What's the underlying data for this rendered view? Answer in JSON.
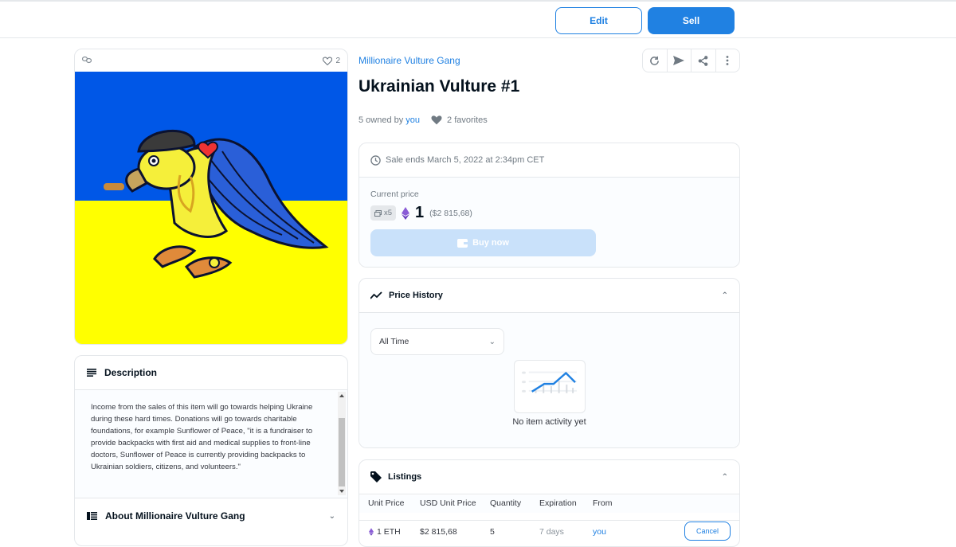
{
  "topbar": {
    "edit_label": "Edit",
    "sell_label": "Sell"
  },
  "media": {
    "favorites_count": "2"
  },
  "description": {
    "title": "Description",
    "text": "Income from the sales of this item will go towards helping Ukraine during these hard times. Donations will go towards charitable foundations, for example Sunflower of Peace, \"it is a fundraiser to provide backpacks with first aid and medical supplies to front-line doctors, Sunflower of Peace is currently providing backpacks to Ukrainian soldiers, citizens, and volunteers.\""
  },
  "about": {
    "title": "About Millionaire Vulture Gang"
  },
  "item": {
    "collection": "Millionaire Vulture Gang",
    "title": "Ukrainian Vulture #1",
    "owned_text": "5 owned by",
    "owner": "you",
    "favorites_text": "2 favorites"
  },
  "sale": {
    "ends_text": "Sale ends March 5, 2022 at 2:34pm CET",
    "current_price_label": "Current price",
    "quantity": "x5",
    "price": "1",
    "price_usd": "($2 815,68)",
    "buy_label": "Buy now"
  },
  "price_history": {
    "title": "Price History",
    "range": "All Time",
    "empty_text": "No item activity yet"
  },
  "listings": {
    "title": "Listings",
    "columns": [
      "Unit Price",
      "USD Unit Price",
      "Quantity",
      "Expiration",
      "From"
    ],
    "rows": [
      {
        "unit_price": "1 ETH",
        "usd_price": "$2 815,68",
        "quantity": "5",
        "expiration": "7 days",
        "from": "you",
        "action": "Cancel"
      }
    ]
  },
  "colors": {
    "accent": "#2081e2",
    "flag_blue": "#0057e7",
    "flag_yellow": "#ffff00"
  },
  "icons": [
    "link-icon",
    "heart-icon",
    "refresh-icon",
    "send-icon",
    "share-icon",
    "more-icon",
    "clock-icon",
    "eth-icon",
    "trend-icon",
    "tag-icon",
    "chevron-up-icon",
    "chevron-down-icon",
    "wallet-icon",
    "description-icon",
    "about-icon"
  ]
}
